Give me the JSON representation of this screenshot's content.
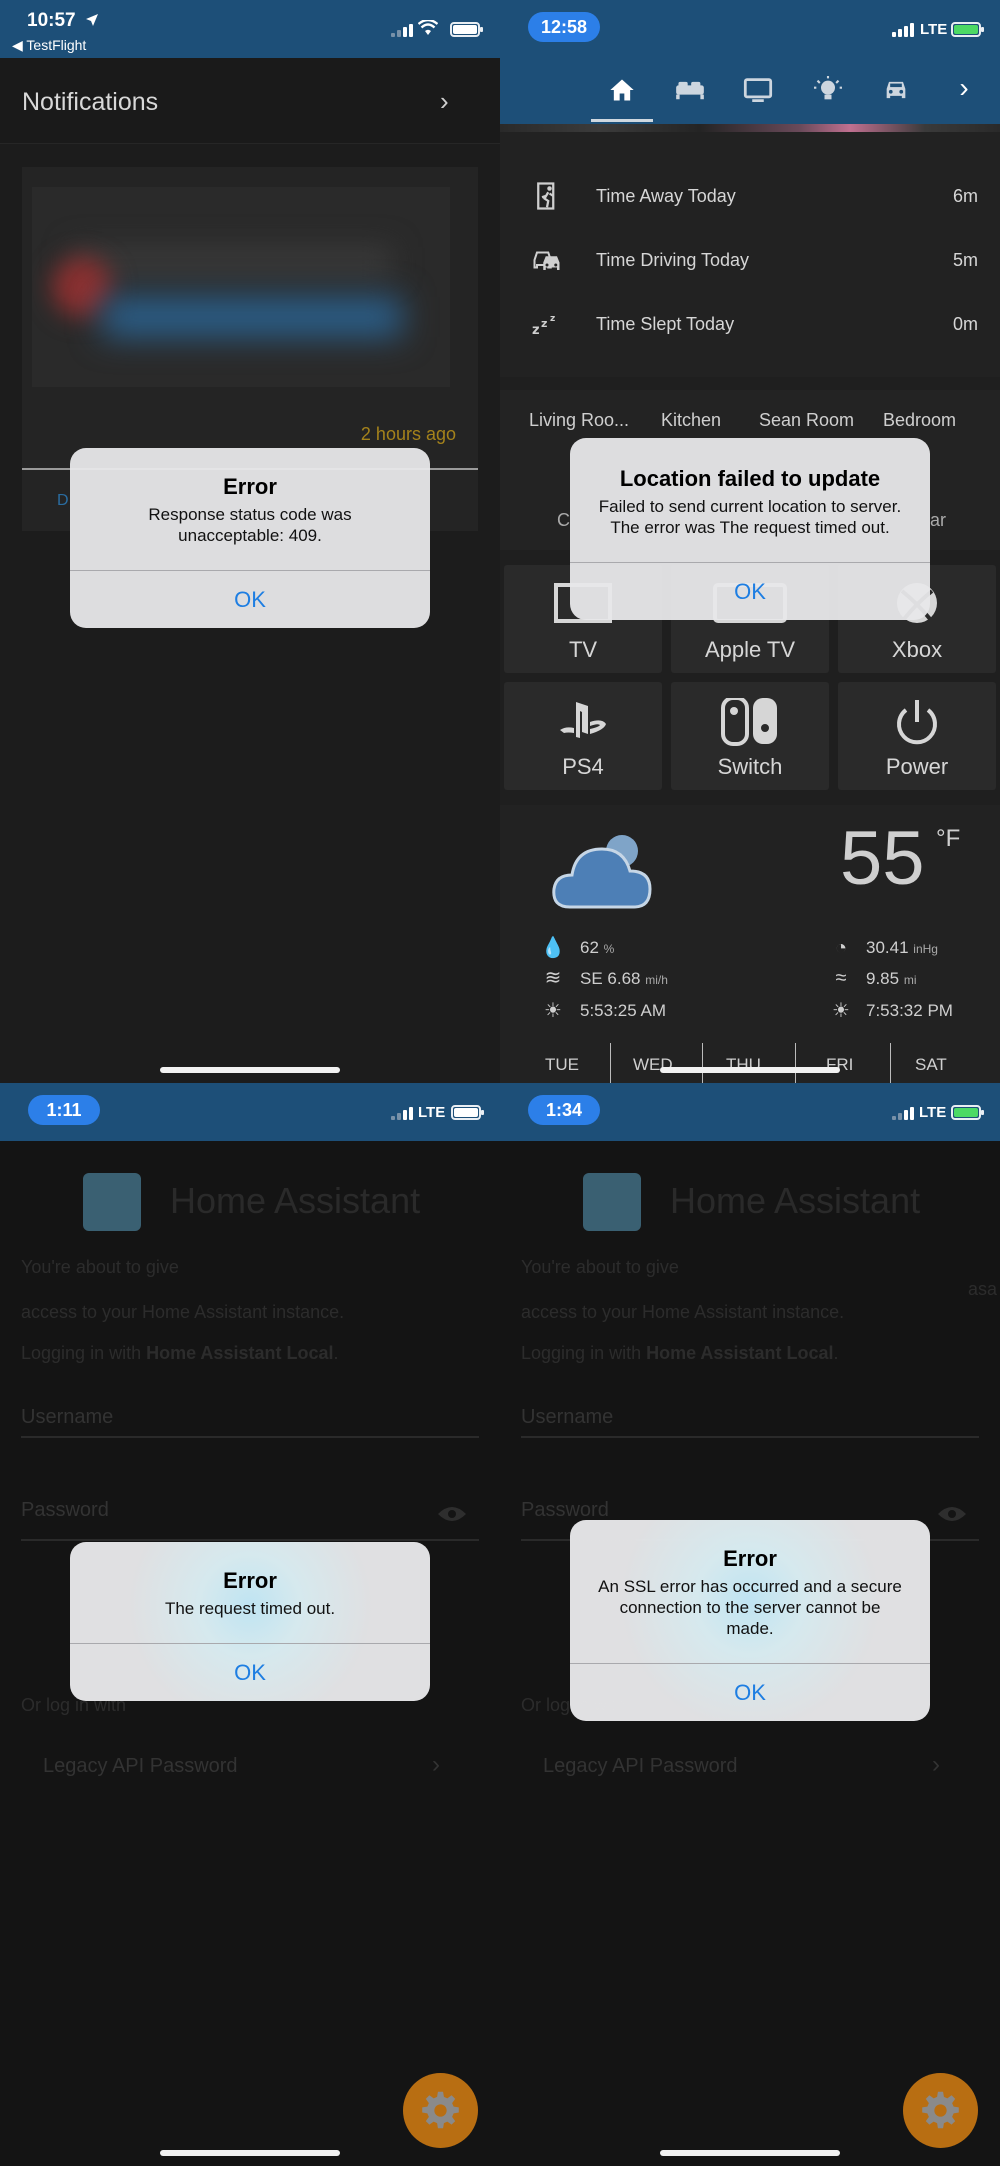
{
  "panel1": {
    "status": {
      "time": "10:57",
      "back_label": "◀ TestFlight"
    },
    "header": {
      "title": "Notifications",
      "chevron": "›"
    },
    "card": {
      "timestamp": "2 hours ago",
      "button_partial": "D"
    },
    "alert": {
      "title": "Error",
      "message": "Response status code was unacceptable: 409.",
      "ok": "OK"
    }
  },
  "panel2": {
    "status": {
      "time": "12:58",
      "network": "LTE"
    },
    "tabs": [
      {
        "icon": "home-icon"
      },
      {
        "icon": "bed-icon"
      },
      {
        "icon": "tv-icon"
      },
      {
        "icon": "lightbulb-icon"
      },
      {
        "icon": "car-icon"
      },
      {
        "icon": "chevron-right-icon",
        "glyph": "›"
      }
    ],
    "stats": [
      {
        "icon": "walking-icon",
        "label": "Time Away Today",
        "value": "6m"
      },
      {
        "icon": "car-icon",
        "label": "Time Driving Today",
        "value": "5m"
      },
      {
        "icon": "sleep-icon",
        "label": "Time Slept Today",
        "value": "0m"
      }
    ],
    "rooms": [
      "Living Roo...",
      "Kitchen",
      "Sean Room",
      "Bedroom"
    ],
    "room_partials": {
      "left": "C",
      "right": "ar"
    },
    "tiles_row1": [
      "TV",
      "Apple TV",
      "Xbox"
    ],
    "tiles_row2": [
      "PS4",
      "Switch",
      "Power"
    ],
    "weather": {
      "temperature": "55",
      "unit": "°F",
      "humidity": "62",
      "humidity_unit": "%",
      "wind": "SE 6.68",
      "wind_unit": "mi/h",
      "sunrise": "5:53:25 AM",
      "pressure": "30.41",
      "pressure_unit": "inHg",
      "visibility": "9.85",
      "visibility_unit": "mi",
      "sunset": "7:53:32 PM",
      "days": [
        "TUE",
        "WED",
        "THU",
        "FRI",
        "SAT"
      ]
    },
    "alert": {
      "title": "Location failed to update",
      "message": "Failed to send current location to server. The error was The request timed out.",
      "ok": "OK"
    }
  },
  "panel3": {
    "status": {
      "time": "1:11",
      "network": "LTE"
    },
    "login": {
      "title": "Home Assistant",
      "line1": "You're about to give",
      "line2": "access to your Home Assistant instance.",
      "line3_prefix": "Logging in with ",
      "line3_bold": "Home Assistant Local",
      "line3_suffix": ".",
      "username": "Username",
      "password": "Password",
      "or_log": "Or log in with",
      "legacy": "Legacy API Password",
      "chevron": "›"
    },
    "alert": {
      "title": "Error",
      "message": "The request timed out.",
      "ok": "OK"
    }
  },
  "panel4": {
    "status": {
      "time": "1:34",
      "network": "LTE"
    },
    "login": {
      "title": "Home Assistant",
      "line1": "You're about to give",
      "line1_right": "asa",
      "line2": "access to your Home Assistant instance.",
      "line3_prefix": "Logging in with ",
      "line3_bold": "Home Assistant Local",
      "line3_suffix": ".",
      "username": "Username",
      "password": "Password",
      "or_log": "Or log in with",
      "legacy": "Legacy API Password",
      "chevron": "›"
    },
    "alert": {
      "title": "Error",
      "message": "An SSL error has occurred and a secure connection to the server cannot be made.",
      "ok": "OK"
    }
  },
  "colors": {
    "status_bar": "#1d4f78",
    "accent_blue": "#1e7ee2",
    "time_pill": "#2c7fe8",
    "fab_orange": "#b86e12",
    "timestamp_gold": "#a4821b"
  }
}
